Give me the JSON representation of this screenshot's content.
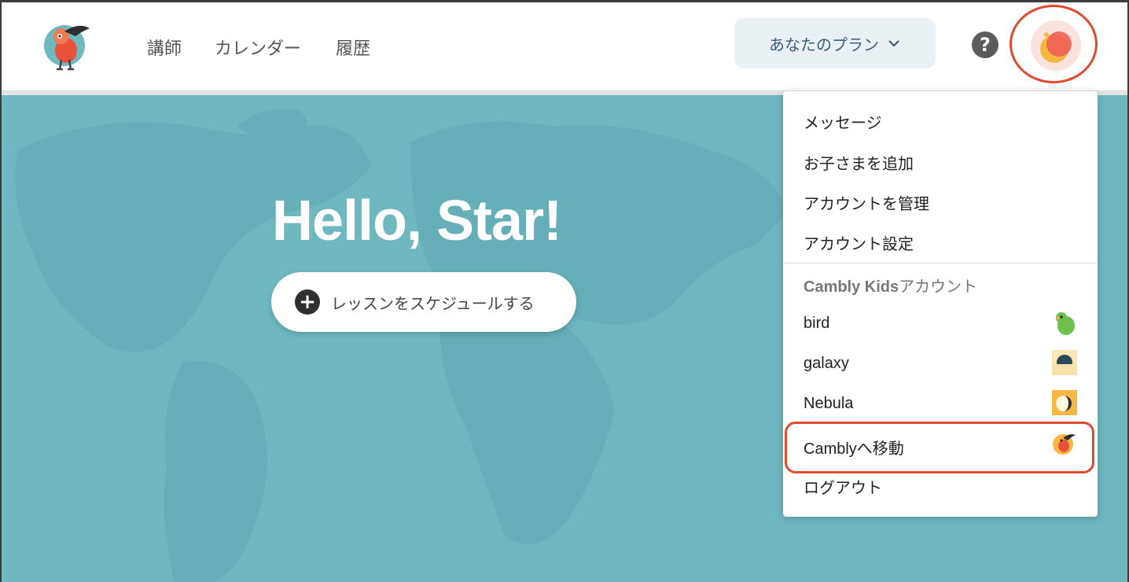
{
  "nav": {
    "links": [
      "講師",
      "カレンダー",
      "履歴"
    ],
    "plan_label": "あなたのプラン",
    "help_label": "?"
  },
  "hero": {
    "greeting": "Hello, Star!",
    "schedule_label": "レッスンをスケジュールする",
    "plus_symbol": "+"
  },
  "menu": {
    "items": [
      "メッセージ",
      "お子さまを追加",
      "アカウントを管理",
      "アカウント設定"
    ],
    "section_title_latin": "Cambly Kids",
    "section_title_jp": "アカウント",
    "kids": [
      {
        "name": "bird",
        "icon": "parrot-avatar-icon"
      },
      {
        "name": "galaxy",
        "icon": "galaxy-avatar-icon"
      },
      {
        "name": "Nebula",
        "icon": "nebula-avatar-icon"
      }
    ],
    "go_to_cambly": "Camblyへ移動",
    "go_to_cambly_icon": "cambly-bird-icon",
    "logout": "ログアウト"
  },
  "colors": {
    "hero_bg": "#6fb8c0",
    "highlight": "#e04a2e",
    "plan_bg": "#eaf1f5"
  }
}
